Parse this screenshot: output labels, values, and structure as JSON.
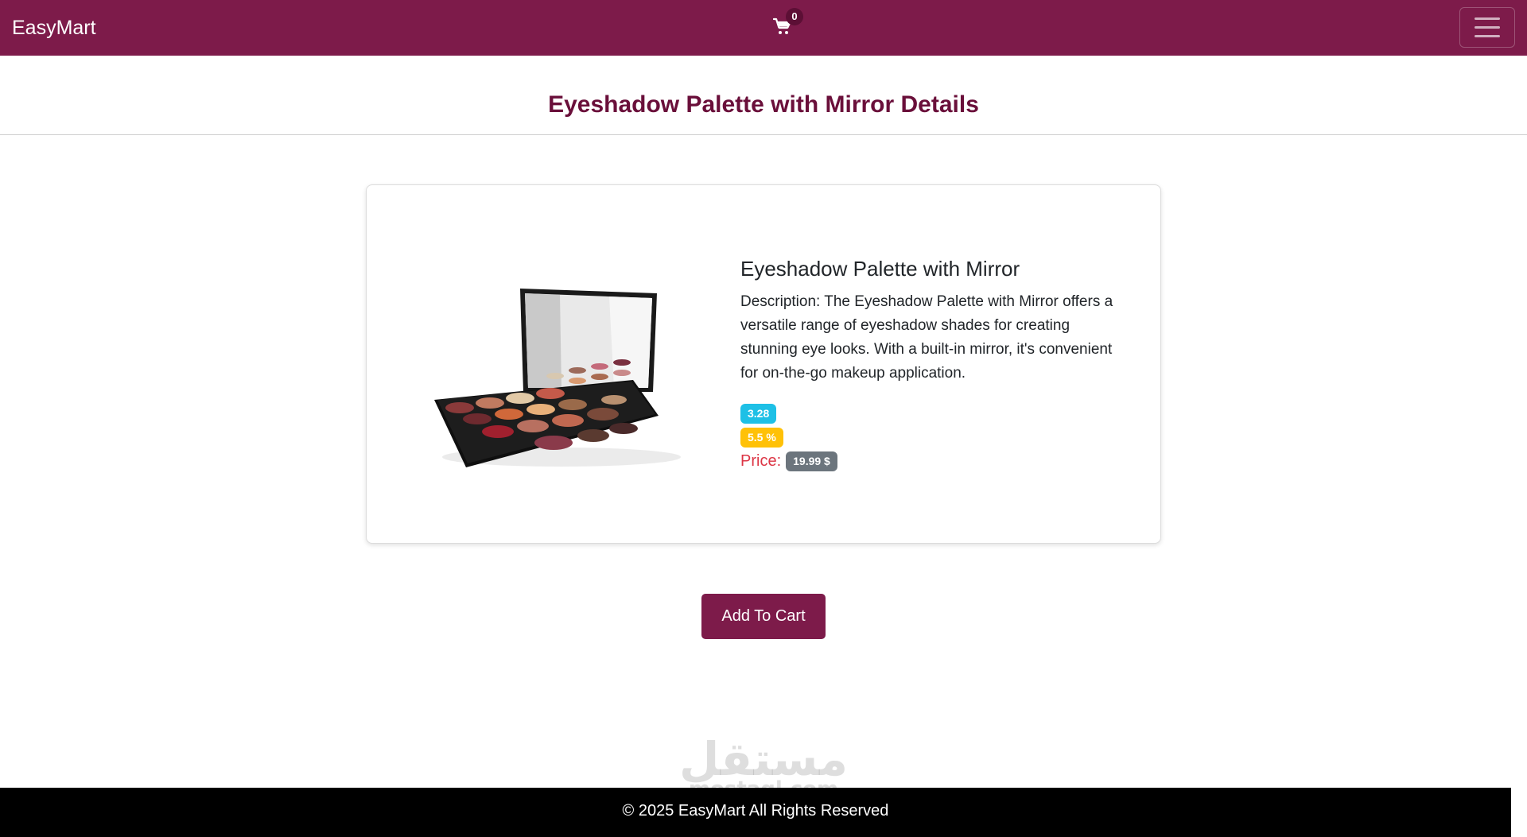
{
  "navbar": {
    "brand": "EasyMart",
    "cart_icon": "shopping-cart-icon",
    "cart_count": "0",
    "menu_icon": "hamburger-menu-icon",
    "background_color": "#7d1b4a"
  },
  "page": {
    "title": "Eyeshadow Palette with Mirror Details"
  },
  "product": {
    "name": "Eyeshadow Palette with Mirror",
    "description": "Description: The Eyeshadow Palette with Mirror offers a versatile range of eyeshadow shades for creating stunning eye looks. With a built-in mirror, it's convenient for on-the-go makeup application.",
    "rating": "3.28",
    "discount": "5.5 %",
    "price_label": "Price:",
    "price": "19.99 $",
    "image_alt": "Eyeshadow palette with mirror"
  },
  "actions": {
    "add_to_cart": "Add To Cart"
  },
  "watermark": {
    "arabic": "مستقل",
    "latin": "mostaql.com"
  },
  "footer": {
    "text": "© 2025 EasyMart All Rights Reserved"
  },
  "colors": {
    "brand": "#7d1b4a",
    "title": "#6a0f3a",
    "rating_badge": "#1ec0e6",
    "discount_badge": "#ffc107",
    "price_badge": "#6c757d",
    "price_label": "#dc3545"
  }
}
